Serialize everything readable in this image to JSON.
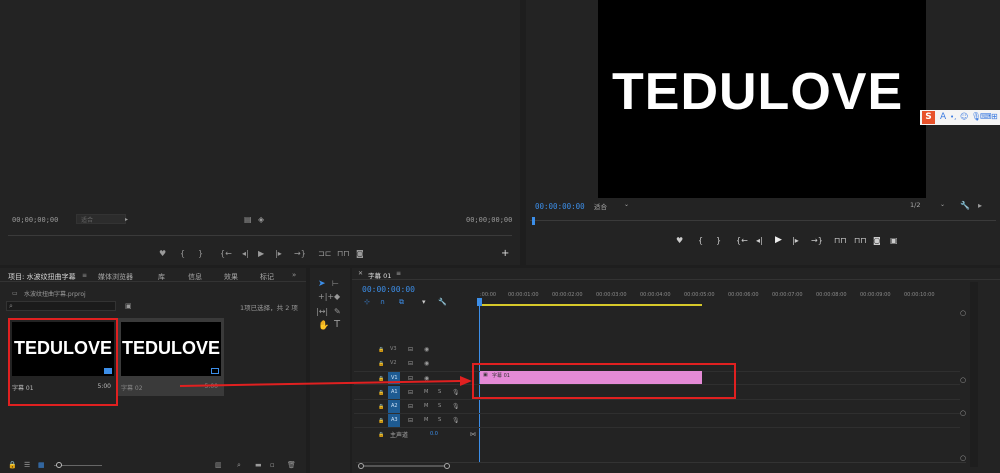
{
  "source_monitor": {
    "timecode_left": "00;00;00;00",
    "timecode_right": "00;00;00;00",
    "fit_label": "适合"
  },
  "program_monitor": {
    "preview_text": "TEDULOVE",
    "timecode": "00:00:00:00",
    "fit_label": "适合",
    "resolution": "1/2"
  },
  "ime_toolbar": {
    "logo": "S",
    "letter": "A"
  },
  "project_panel": {
    "tabs": [
      "项目: 水波纹扭曲字幕",
      "媒体浏览器",
      "库",
      "信息",
      "效果",
      "标记"
    ],
    "filename": "水波纹扭曲字幕.prproj",
    "selection_info": "1项已选择，共 2 项",
    "items": [
      {
        "name": "字幕 01",
        "duration": "5:00",
        "preview": "TEDULOVE"
      },
      {
        "name": "字幕 02",
        "duration": "5:00",
        "preview": "TEDULOVE"
      }
    ]
  },
  "timeline": {
    "tab": "字幕 01",
    "timecode": "00:00:00:00",
    "ruler": [
      ":00:00",
      "00:00:01:00",
      "00:00:02:00",
      "00:00:03:00",
      "00:00:04:00",
      "00:00:05:00",
      "00:00:06:00",
      "00:00:07:00",
      "00:00:08:00",
      "00:00:09:00",
      "00:00:10:00"
    ],
    "tracks": {
      "v3": "V3",
      "v2": "V2",
      "v1": "V1",
      "a1": "A1",
      "a2": "A2",
      "a3": "A3",
      "m": "M",
      "s": "S",
      "master": "主声道",
      "master_val": "0.0"
    },
    "clip_label": "字幕 01"
  },
  "colors": {
    "accent": "#3c8ee8",
    "clip": "#e48ad6",
    "annotation": "#e02020"
  }
}
